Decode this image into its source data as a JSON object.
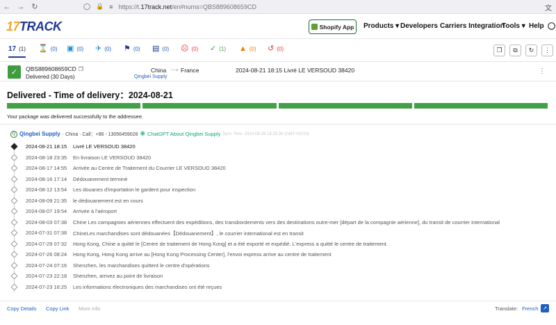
{
  "browser": {
    "url_prefix": "https://t.",
    "url_domain": "17track.net",
    "url_suffix": "/en#nums=QBS889608659CD"
  },
  "header": {
    "logo_num": "17",
    "logo_text": "TRACK",
    "shopify_label": "Shopify App",
    "menu": [
      "Products",
      "Developers",
      "Carriers Integration",
      "Tools",
      "Help"
    ]
  },
  "tabs": [
    {
      "icon": "17-logo-icon",
      "count": "(1)"
    },
    {
      "icon": "hourglass-icon",
      "count": "(0)"
    },
    {
      "icon": "package-icon",
      "count": "(0)"
    },
    {
      "icon": "plane-icon",
      "count": "(0)"
    },
    {
      "icon": "flag-icon",
      "count": "(0)"
    },
    {
      "icon": "delivery-icon",
      "count": "(0)"
    },
    {
      "icon": "sad-face-icon",
      "count": "(0)"
    },
    {
      "icon": "check-icon",
      "count": "(1)"
    },
    {
      "icon": "alert-icon",
      "count": "(0)"
    },
    {
      "icon": "expired-icon",
      "count": "(0)"
    }
  ],
  "package": {
    "tracking_number": "QBS889608659CD",
    "status": "Delivered (30 Days)",
    "origin": "China",
    "origin_carrier": "Qingbei Supply",
    "destination": "France",
    "latest_event": "2024-08-21 18:15  Livré LE VERSOUD 38420"
  },
  "delivered_title": "Delivered - Time of delivery：2024-08-21",
  "progress_segments": 4,
  "success_message": "Your package was delivered successfully to the addressee.",
  "carrier": {
    "name": "Qingbei Supply",
    "meta": "· China · Call：+86 - 13056459028",
    "chatgpt": "ChatGPT About Qingbei Supply",
    "sync": "Sync Time: 2024-08-29 18:25:36 (GMT+02:00)"
  },
  "events": [
    {
      "date": "2024-08-21 18:15",
      "desc": "Livré LE VERSOUD 38420"
    },
    {
      "date": "2024-08-18 23:35",
      "desc": "En livraison LE VERSOUD 38420"
    },
    {
      "date": "2024-08-17 14:55",
      "desc": "Arrivée au Centre de Traitement du Courrier LE VERSOUD 38420"
    },
    {
      "date": "2024-08-16 17:14",
      "desc": "Dédouanement terminé"
    },
    {
      "date": "2024-08-12 13:54",
      "desc": "Les douanes d'importation le gardent pour inspection"
    },
    {
      "date": "2024-08-09 21:35",
      "desc": "le dédouanement est en cours"
    },
    {
      "date": "2024-08-07 19:54",
      "desc": "Arrivée à l'aéroport"
    },
    {
      "date": "2024-08-03 07:38",
      "desc": "Chine Les compagnies aériennes effectuent des expéditions, des transbordements vers des destinations outre-mer [départ de la compagnie aérienne], du transit de courrier international"
    },
    {
      "date": "2024-07-31 07:38",
      "desc": "ChineLes marchandises sont dédouanées【Dédouanement】, le courrier international est en transit"
    },
    {
      "date": "2024-07-29 07:32",
      "desc": "Hong Kong, Chine a quitté le [Centre de traitement de Hong Kong] et a été exporté et expédié. L'express a quitté le centre de traitement."
    },
    {
      "date": "2024-07-26 08:24",
      "desc": "Hong Kong, Hong Kong arrive au [Hong Kong Processing Center], l'envoi express arrive au centre de traitement"
    },
    {
      "date": "2024-07-24 07:16",
      "desc": "Shenzhen, les marchandises quittent le centre d'opérations"
    },
    {
      "date": "2024-07-23 22:18",
      "desc": "Shenzhen, arrivez au point de livraison"
    },
    {
      "date": "2024-07-23 16:25",
      "desc": "Les informations électroniques des marchandises ont été reçues"
    }
  ],
  "footer": {
    "copy_details": "Copy Details",
    "copy_link": "Copy Link",
    "more_info": "More info",
    "translate_label": "Translate:",
    "translate_lang": "French"
  }
}
